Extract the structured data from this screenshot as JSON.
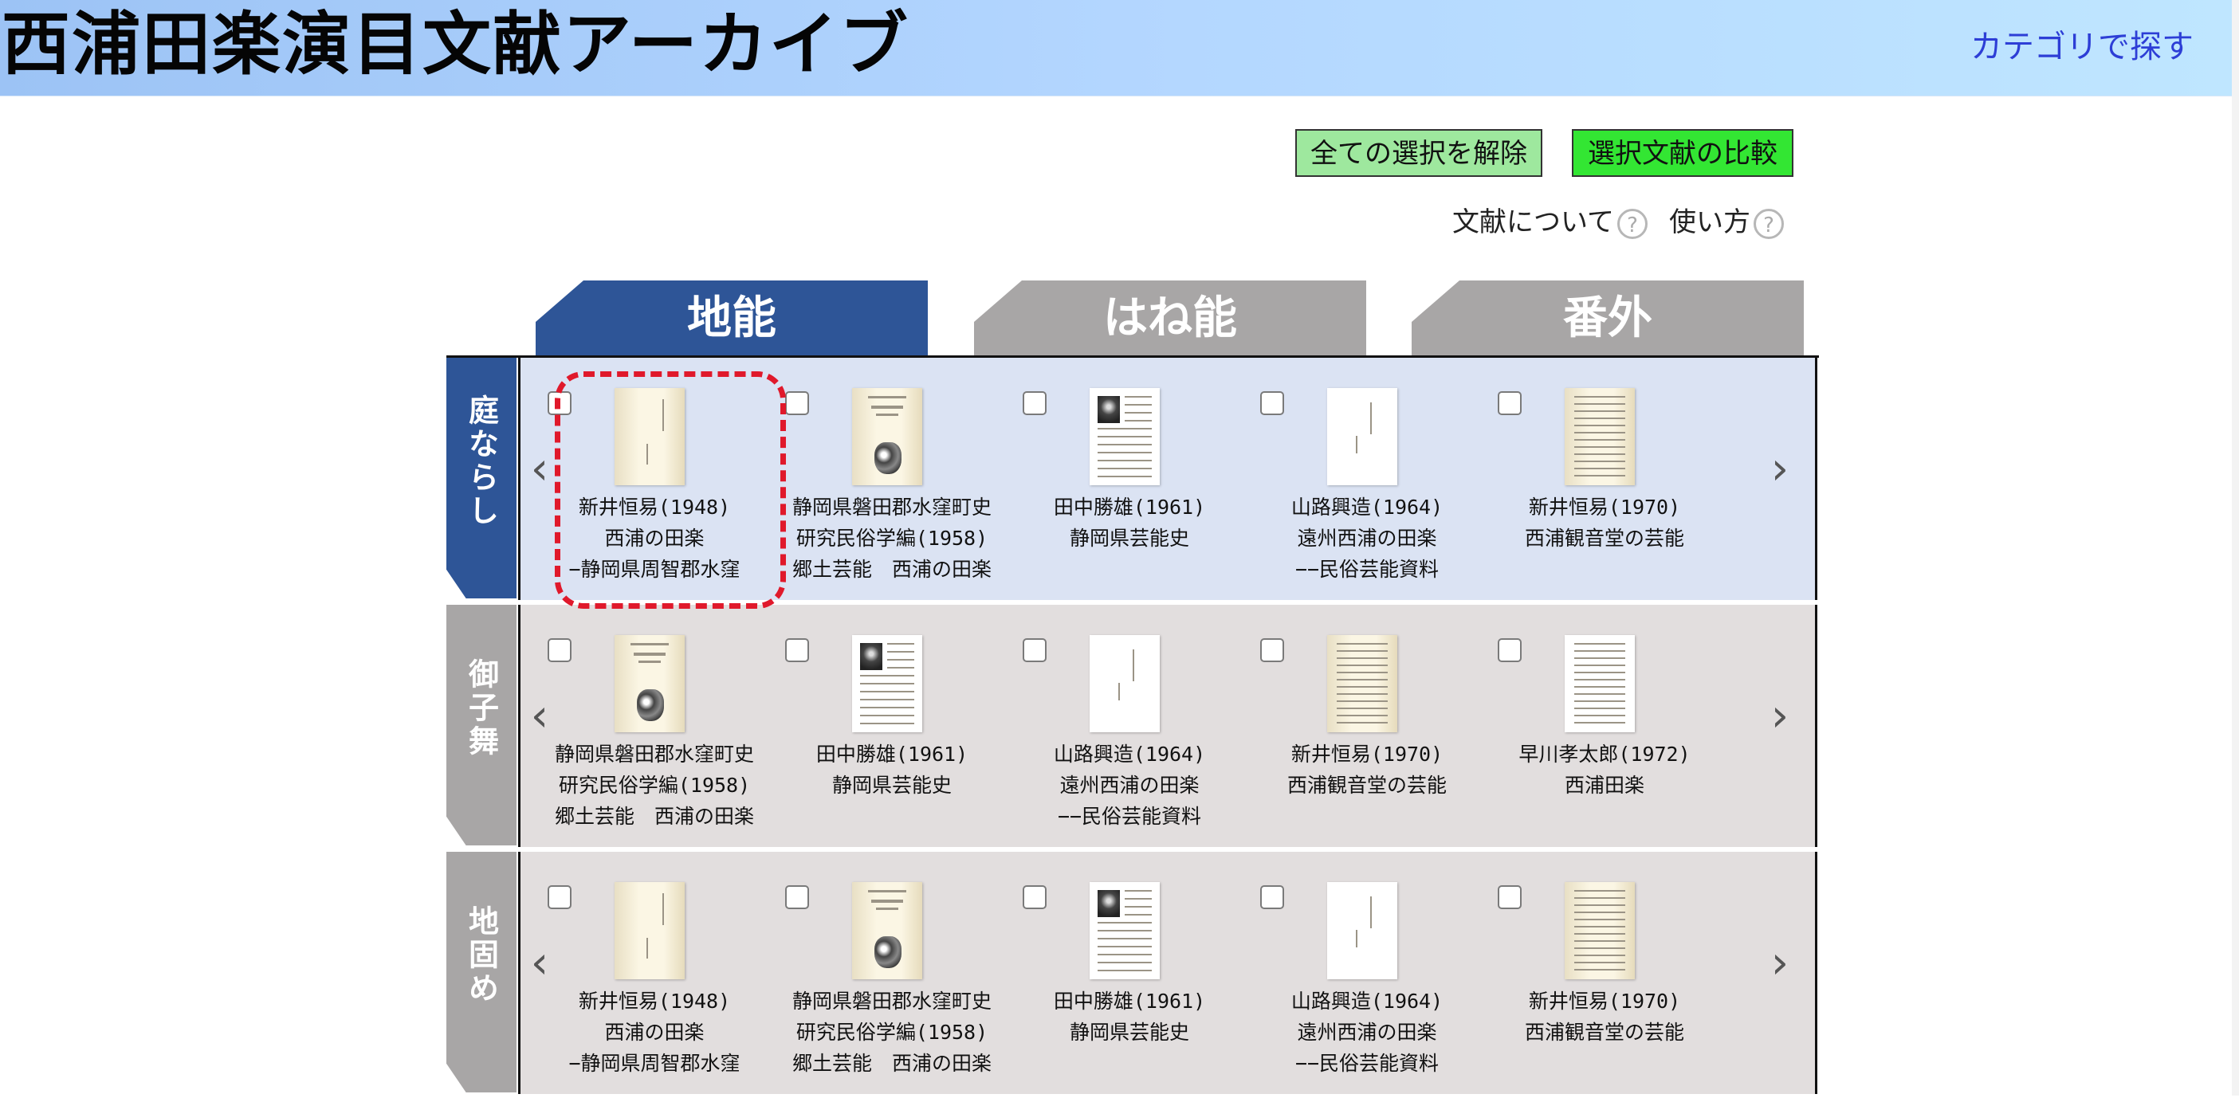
{
  "header": {
    "title": "西浦田楽演目文献アーカイブ",
    "category_link": "カテゴリで探す"
  },
  "actions": {
    "clear_label": "全ての選択を解除",
    "compare_label": "選択文献の比較"
  },
  "help_links": {
    "about_label": "文献について",
    "usage_label": "使い方",
    "help_glyph": "?"
  },
  "tabs": [
    {
      "label": "地能",
      "active": true
    },
    {
      "label": "はね能",
      "active": false
    },
    {
      "label": "番外",
      "active": false
    }
  ],
  "arrows": {
    "left": "‹",
    "right": "›"
  },
  "rows": [
    {
      "label": "庭ならし",
      "items": [
        {
          "lines": [
            "新井恒易(1948)",
            "西浦の田楽",
            "−静岡県周智郡水窪"
          ],
          "thumb": "plain-cream",
          "highlighted": true
        },
        {
          "lines": [
            "静岡県磐田郡水窪町史",
            "研究民俗学編(1958)",
            "郷土芸能　西浦の田楽"
          ],
          "thumb": "mask-cover"
        },
        {
          "lines": [
            "田中勝雄(1961)",
            "静岡県芸能史"
          ],
          "thumb": "photo-text"
        },
        {
          "lines": [
            "山路興造(1964)",
            "遠州西浦の田楽",
            "−−民俗芸能資料"
          ],
          "thumb": "white-title"
        },
        {
          "lines": [
            "新井恒易(1970)",
            "西浦観音堂の芸能"
          ],
          "thumb": "cream-text"
        }
      ]
    },
    {
      "label": "御子舞",
      "items": [
        {
          "lines": [
            "静岡県磐田郡水窪町史",
            "研究民俗学編(1958)",
            "郷土芸能　西浦の田楽"
          ],
          "thumb": "mask-cover"
        },
        {
          "lines": [
            "田中勝雄(1961)",
            "静岡県芸能史"
          ],
          "thumb": "photo-text"
        },
        {
          "lines": [
            "山路興造(1964)",
            "遠州西浦の田楽",
            "−−民俗芸能資料"
          ],
          "thumb": "white-title"
        },
        {
          "lines": [
            "新井恒易(1970)",
            "西浦観音堂の芸能"
          ],
          "thumb": "cream-text"
        },
        {
          "lines": [
            "早川孝太郎(1972)",
            "西浦田楽"
          ],
          "thumb": "white-text"
        }
      ]
    },
    {
      "label": "地固め",
      "items": [
        {
          "lines": [
            "新井恒易(1948)",
            "西浦の田楽",
            "−静岡県周智郡水窪"
          ],
          "thumb": "plain-cream"
        },
        {
          "lines": [
            "静岡県磐田郡水窪町史",
            "研究民俗学編(1958)",
            "郷土芸能　西浦の田楽"
          ],
          "thumb": "mask-cover"
        },
        {
          "lines": [
            "田中勝雄(1961)",
            "静岡県芸能史"
          ],
          "thumb": "photo-text"
        },
        {
          "lines": [
            "山路興造(1964)",
            "遠州西浦の田楽",
            "−−民俗芸能資料"
          ],
          "thumb": "white-title"
        },
        {
          "lines": [
            "新井恒易(1970)",
            "西浦観音堂の芸能"
          ],
          "thumb": "cream-text"
        }
      ]
    }
  ]
}
